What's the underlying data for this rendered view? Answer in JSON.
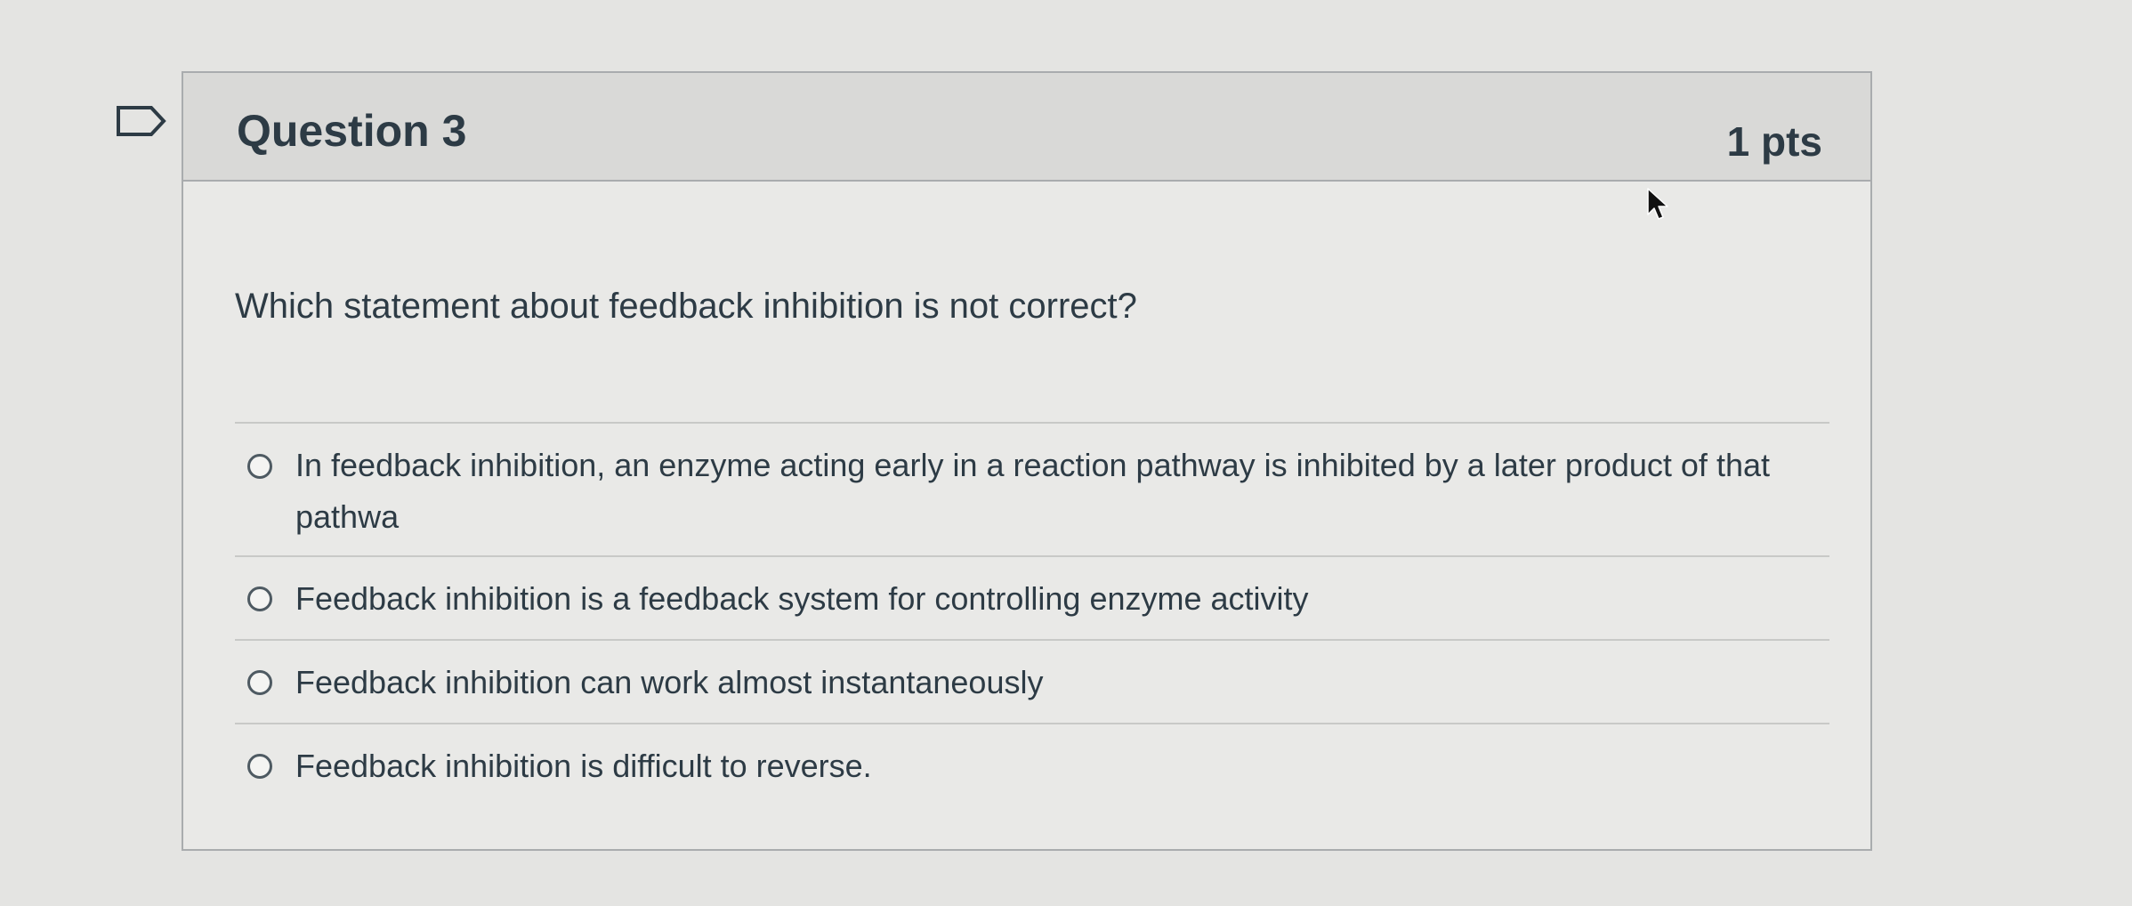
{
  "question": {
    "title": "Question 3",
    "points": "1 pts",
    "text": "Which statement about feedback inhibition is not correct?",
    "answers": [
      {
        "label": "In feedback inhibition, an enzyme acting early in a reaction pathway is inhibited by a later product of that pathwa"
      },
      {
        "label": "Feedback inhibition is a feedback system for controlling enzyme activity"
      },
      {
        "label": "Feedback inhibition can work almost instantaneously"
      },
      {
        "label": "Feedback inhibition is difficult to reverse."
      }
    ]
  },
  "icons": {
    "bookmark": "bookmark-flag-icon",
    "cursor": "mouse-pointer-icon",
    "radio": "radio-button-unselected"
  }
}
